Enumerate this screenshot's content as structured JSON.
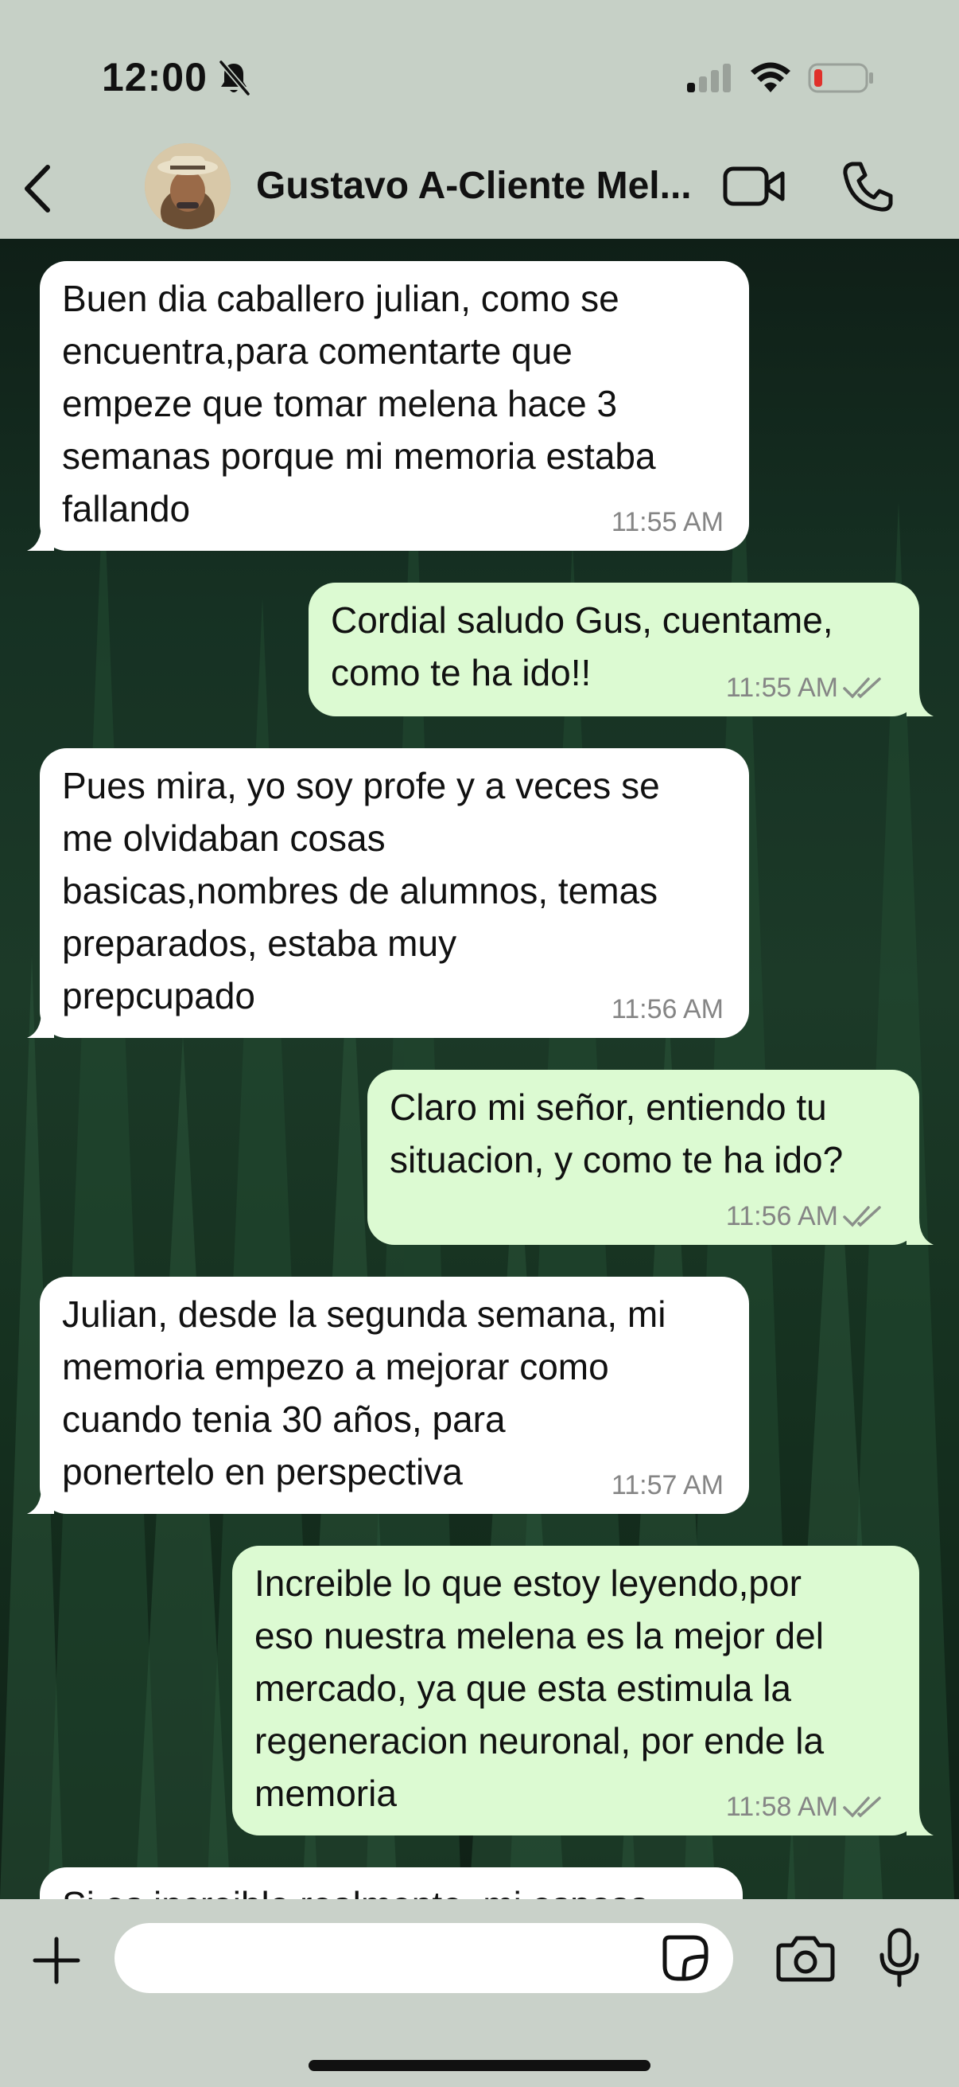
{
  "status_bar": {
    "time": "12:00",
    "icons": [
      "bell-slash-icon",
      "cellular-signal-icon",
      "wifi-icon",
      "battery-low-icon"
    ]
  },
  "header": {
    "back_icon": "chevron-left-icon",
    "contact_name": "Gustavo A-Cliente Mel...",
    "video_icon": "video-camera-icon",
    "call_icon": "phone-icon"
  },
  "messages": [
    {
      "direction": "incoming",
      "text": "Buen dia caballero julian, como se\nencuentra,para comentarte que\nempeze que tomar melena hace 3\nsemanas porque mi memoria estaba\nfallando",
      "time": "11:55 AM"
    },
    {
      "direction": "outgoing",
      "text": "Cordial saludo Gus, cuentame,\ncomo te ha ido!!",
      "time": "11:55 AM",
      "status": "read"
    },
    {
      "direction": "incoming",
      "text": "Pues mira, yo soy profe y a veces se\nme olvidaban cosas\nbasicas,nombres de alumnos, temas\npreparados, estaba muy\nprepcupado",
      "time": "11:56 AM"
    },
    {
      "direction": "outgoing",
      "text": "Claro mi señor, entiendo tu\nsituacion, y como te ha ido?",
      "time": "11:56 AM",
      "status": "read"
    },
    {
      "direction": "incoming",
      "text": "Julian, desde la segunda semana, mi\nmemoria empezo a mejorar como\ncuando tenia 30 años, para\nponertelo en perspectiva",
      "time": "11:57 AM"
    },
    {
      "direction": "outgoing",
      "text": "Increible lo que estoy leyendo,por\neso nuestra melena es la mejor del\nmercado, ya que esta estimula la\nregeneracion neuronal, por ende la\nmemoria",
      "time": "11:58 AM",
      "status": "read"
    },
    {
      "direction": "incoming",
      "text": "Si es increible realmente, mi esposa",
      "time": ""
    }
  ],
  "composer": {
    "plus_icon": "plus-icon",
    "input_value": "",
    "sticker_icon": "sticker-icon",
    "camera_icon": "camera-icon",
    "mic_icon": "microphone-icon"
  },
  "colors": {
    "header_bg": "#c6d0c6",
    "incoming_bubble": "#ffffff",
    "outgoing_bubble": "#dcfad2",
    "read_ticks": "#8a8f8a",
    "timestamp": "#858585"
  }
}
